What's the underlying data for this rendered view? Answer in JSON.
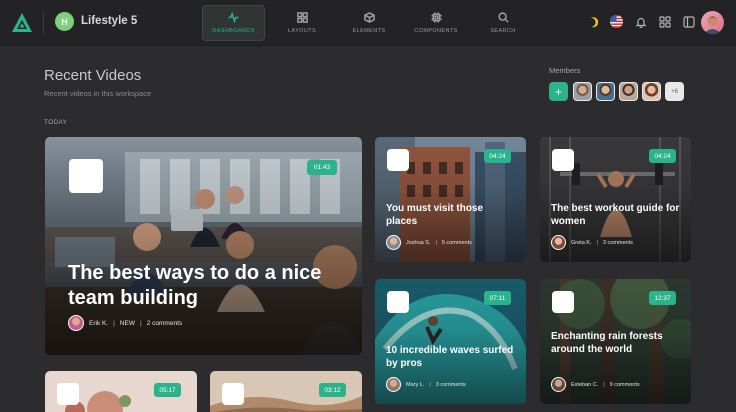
{
  "app": {
    "workspace_initial": "H",
    "workspace_name": "Lifestyle 5"
  },
  "nav": [
    {
      "label": "DASHBOARDS",
      "icon": "activity-icon",
      "active": true
    },
    {
      "label": "LAYOUTS",
      "icon": "grid-icon",
      "active": false
    },
    {
      "label": "ELEMENTS",
      "icon": "cube-icon",
      "active": false
    },
    {
      "label": "COMPONENTS",
      "icon": "chip-icon",
      "active": false
    },
    {
      "label": "SEARCH",
      "icon": "search-icon",
      "active": false
    }
  ],
  "topbar_icons": [
    "moon-icon",
    "us-flag-icon",
    "bell-icon",
    "apps-grid-icon",
    "sidebar-toggle-icon",
    "user-avatar"
  ],
  "header": {
    "title": "Recent Videos",
    "subtitle": "Recent videos in this workspace",
    "members_label": "Members",
    "members_more": "+6"
  },
  "section_label": "TODAY",
  "featured": {
    "duration": "01:43",
    "title": "The best ways to do a nice team building",
    "author": "Erik K.",
    "tag": "NEW",
    "comments": "2 comments"
  },
  "videos": [
    {
      "duration": "04:24",
      "title": "You must visit those places",
      "author": "Joshua S.",
      "comments": "5 comments"
    },
    {
      "duration": "04:24",
      "title": "The best workout guide for women",
      "author": "Greta K.",
      "comments": "3 comments"
    },
    {
      "duration": "07:11",
      "title": "10 incredible waves surfed by pros",
      "author": "Mary L.",
      "comments": "3 comments"
    },
    {
      "duration": "12:37",
      "title": "Enchanting rain forests around the world",
      "author": "Esteban C.",
      "comments": "9 comments"
    },
    {
      "duration": "05:17"
    },
    {
      "duration": "03:12"
    }
  ],
  "colors": {
    "accent": "#2bb38c",
    "background": "#2c2c2e",
    "topbar": "#232325"
  }
}
